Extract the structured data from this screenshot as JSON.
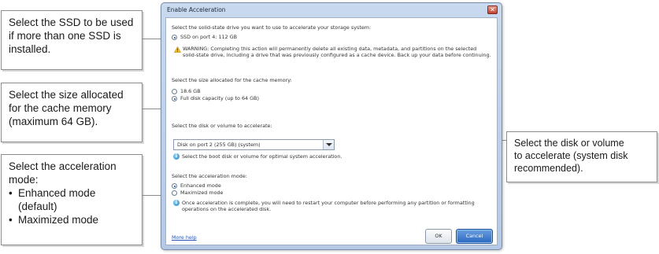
{
  "callouts": {
    "ssd": {
      "line1": "Select the SSD to be used",
      "line2": "if more than one SSD is",
      "line3": "installed."
    },
    "cache": {
      "line1": "Select the size allocated",
      "line2": "for the cache memory",
      "line3": "(maximum 64 GB)."
    },
    "accel": {
      "line1": "Select the acceleration",
      "line2": "mode:",
      "bullet1_line1": "Enhanced mode",
      "bullet1_line2": "(default)",
      "bullet2": "Maximized mode"
    },
    "disk": {
      "line1": "Select the disk or volume",
      "line2": "to accelerate (system disk",
      "line3": "recommended)."
    }
  },
  "dialog": {
    "title": "Enable Acceleration",
    "close_glyph": "✕",
    "ssd_section": {
      "prompt": "Select the solid-state drive you want to use to accelerate your storage system:",
      "option": "SSD on port 4: 112 GB",
      "warning": "WARNING: Completing this action will permanently delete all existing data, metadata, and partitions on the selected solid-state drive, including a drive that was previously configured as a cache device. Back up your data before continuing."
    },
    "cache_section": {
      "prompt": "Select the size allocated for the cache memory:",
      "option1": "18.6 GB",
      "option2": "Full disk capacity (up to 64 GB)"
    },
    "disk_section": {
      "prompt": "Select the disk or volume to accelerate:",
      "selected": "Disk on port 2 (255 GB) (system)",
      "hint": "Select the boot disk or volume for optimal system acceleration."
    },
    "mode_section": {
      "prompt": "Select the acceleration mode:",
      "option1": "Enhanced mode",
      "option2": "Maximized mode",
      "note": "Once acceleration is complete, you will need to restart your computer before performing any partition or formatting operations on the accelerated disk."
    },
    "footer": {
      "more_help": "More help",
      "ok": "OK",
      "cancel": "Cancel"
    }
  },
  "colors": {
    "accent": "#2a66bf",
    "link": "#2a55b0",
    "callout_border": "#8c8c8c"
  },
  "icons": [
    "warning-icon",
    "info-icon",
    "close-icon",
    "dropdown-arrow-icon"
  ]
}
